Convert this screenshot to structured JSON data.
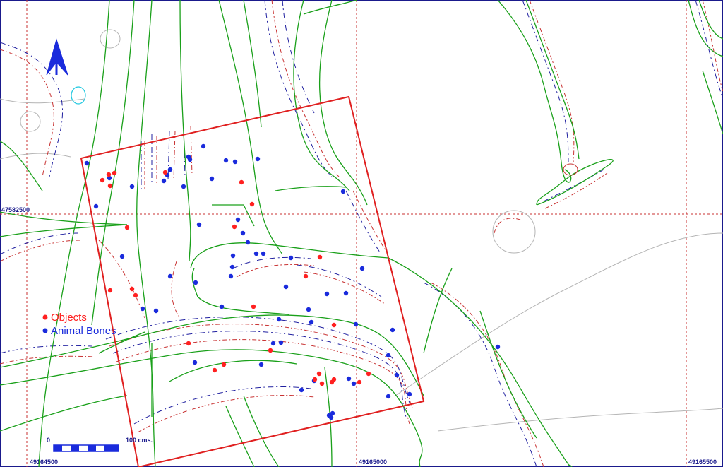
{
  "map": {
    "grid": {
      "x_labels": [
        "49164500",
        "49165000",
        "49165500"
      ],
      "y_labels": [
        "47582500"
      ]
    },
    "legend": {
      "objects_label": "Objects",
      "animal_bones_label": "Animal Bones",
      "objects_color": "#ff2020",
      "animal_bones_color": "#1a2bdc"
    },
    "scale_bar": {
      "start_label": "0",
      "end_label": "100 cms."
    },
    "north_arrow": {
      "icon": "north-arrow-icon",
      "color": "#1a2bdc"
    },
    "excavation_area": {
      "color": "#e02020"
    },
    "colors": {
      "contours_green": "#1aa01a",
      "contours_red": "#c83232",
      "contours_blue": "#2020a0",
      "grid": "#c83232"
    }
  }
}
